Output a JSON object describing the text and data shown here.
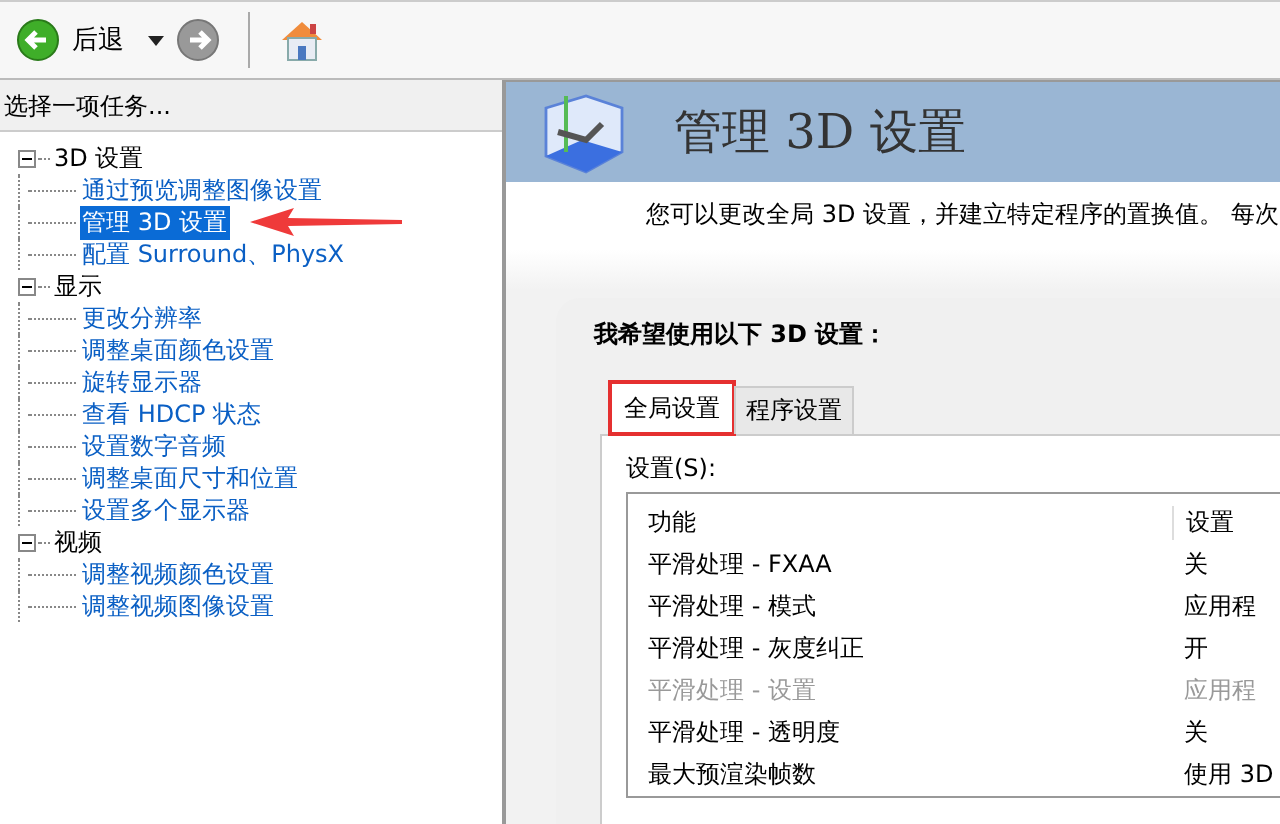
{
  "toolbar": {
    "back_label": "后退"
  },
  "task_panel": {
    "title": "选择一项任务...",
    "tree": [
      {
        "label": "3D 设置",
        "expanded": true,
        "selected": false,
        "children": [
          {
            "label": "通过预览调整图像设置",
            "selected": false
          },
          {
            "label": "管理 3D 设置",
            "selected": true
          },
          {
            "label": "配置 Surround、PhysX",
            "selected": false
          }
        ]
      },
      {
        "label": "显示",
        "expanded": true,
        "selected": false,
        "children": [
          {
            "label": "更改分辨率",
            "selected": false
          },
          {
            "label": "调整桌面颜色设置",
            "selected": false
          },
          {
            "label": "旋转显示器",
            "selected": false
          },
          {
            "label": "查看 HDCP 状态",
            "selected": false
          },
          {
            "label": "设置数字音频",
            "selected": false
          },
          {
            "label": "调整桌面尺寸和位置",
            "selected": false
          },
          {
            "label": "设置多个显示器",
            "selected": false
          }
        ]
      },
      {
        "label": "视频",
        "expanded": true,
        "selected": false,
        "children": [
          {
            "label": "调整视频颜色设置",
            "selected": false
          },
          {
            "label": "调整视频图像设置",
            "selected": false
          }
        ]
      }
    ]
  },
  "page": {
    "title": "管理 3D 设置",
    "description": "您可以更改全局 3D 设置，并建立特定程序的置换值。 每次",
    "prompt": "我希望使用以下 3D 设置：",
    "tabs": [
      {
        "label": "全局设置",
        "selected": true,
        "highlighted": true
      },
      {
        "label": "程序设置",
        "selected": false,
        "highlighted": false
      }
    ],
    "settings_label": "设置(S):",
    "table": {
      "columns": [
        "功能",
        "设置"
      ],
      "rows": [
        {
          "feature": "平滑处理 - FXAA",
          "value": "关",
          "disabled": false
        },
        {
          "feature": "平滑处理 - 模式",
          "value": "应用程",
          "disabled": false
        },
        {
          "feature": "平滑处理 - 灰度纠正",
          "value": "开",
          "disabled": false
        },
        {
          "feature": "平滑处理 - 设置",
          "value": "应用程",
          "disabled": true
        },
        {
          "feature": "平滑处理 - 透明度",
          "value": "关",
          "disabled": false
        },
        {
          "feature": "最大预渲染帧数",
          "value": "使用 3D",
          "disabled": false
        }
      ]
    }
  }
}
